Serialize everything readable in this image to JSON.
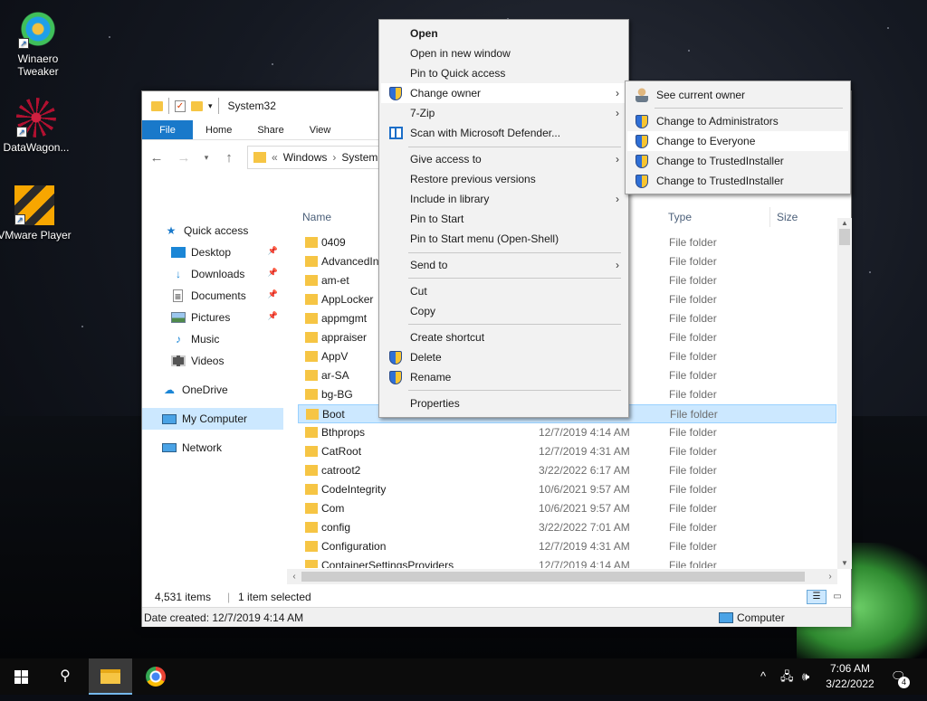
{
  "desktop": {
    "icons": [
      {
        "label": "Winaero Tweaker"
      },
      {
        "label": "DataWagon..."
      },
      {
        "label": "VMware Player"
      }
    ]
  },
  "explorer": {
    "title": "System32",
    "ribbon_tabs": [
      "File",
      "Home",
      "Share",
      "View"
    ],
    "address": {
      "prefix": "«",
      "path": [
        "Windows",
        "System3"
      ]
    },
    "nav": {
      "quick_access": "Quick access",
      "items": [
        "Desktop",
        "Downloads",
        "Documents",
        "Pictures",
        "Music",
        "Videos"
      ],
      "onedrive": "OneDrive",
      "my_computer": "My Computer",
      "network": "Network"
    },
    "columns": {
      "name": "Name",
      "type": "Type",
      "size": "Size"
    },
    "files": [
      {
        "name": "0409",
        "date": "",
        "type": "File folder"
      },
      {
        "name": "AdvancedIn",
        "date": "",
        "type": "File folder"
      },
      {
        "name": "am-et",
        "date": "",
        "type": "File folder"
      },
      {
        "name": "AppLocker",
        "date": "",
        "type": "File folder"
      },
      {
        "name": "appmgmt",
        "date": "",
        "type": "File folder"
      },
      {
        "name": "appraiser",
        "date": "",
        "type": "File folder"
      },
      {
        "name": "AppV",
        "date": "",
        "type": "File folder"
      },
      {
        "name": "ar-SA",
        "date": "",
        "type": "File folder"
      },
      {
        "name": "bg-BG",
        "date": "",
        "type": "File folder"
      },
      {
        "name": "Boot",
        "date": "",
        "type": "File folder",
        "selected": true
      },
      {
        "name": "Bthprops",
        "date": "12/7/2019 4:14 AM",
        "type": "File folder"
      },
      {
        "name": "CatRoot",
        "date": "12/7/2019 4:31 AM",
        "type": "File folder"
      },
      {
        "name": "catroot2",
        "date": "3/22/2022 6:17 AM",
        "type": "File folder"
      },
      {
        "name": "CodeIntegrity",
        "date": "10/6/2021 9:57 AM",
        "type": "File folder"
      },
      {
        "name": "Com",
        "date": "10/6/2021 9:57 AM",
        "type": "File folder"
      },
      {
        "name": "config",
        "date": "3/22/2022 7:01 AM",
        "type": "File folder"
      },
      {
        "name": "Configuration",
        "date": "12/7/2019 4:31 AM",
        "type": "File folder"
      },
      {
        "name": "ContainerSettingsProviders",
        "date": "12/7/2019 4:14 AM",
        "type": "File folder"
      }
    ],
    "status": {
      "items": "4,531 items",
      "selected": "1 item selected"
    },
    "details": {
      "created": "Date created: 12/7/2019 4:14 AM",
      "location": "Computer"
    }
  },
  "context_menu": {
    "items": [
      "Open",
      "Open in new window",
      "Pin to Quick access",
      "Change owner",
      "7-Zip",
      "Scan with Microsoft Defender...",
      "Give access to",
      "Restore previous versions",
      "Include in library",
      "Pin to Start",
      "Pin to Start menu (Open-Shell)",
      "Send to",
      "Cut",
      "Copy",
      "Create shortcut",
      "Delete",
      "Rename",
      "Properties"
    ]
  },
  "submenu": {
    "items": [
      "See current owner",
      "Change to Administrators",
      "Change to Everyone",
      "Change to TrustedInstaller",
      "Change to TrustedInstaller"
    ]
  },
  "taskbar": {
    "time": "7:06 AM",
    "date": "3/22/2022",
    "notifications": "4"
  },
  "colors": {
    "accent": "#1979ca",
    "selection": "#cce8ff",
    "folder": "#f6c544"
  }
}
